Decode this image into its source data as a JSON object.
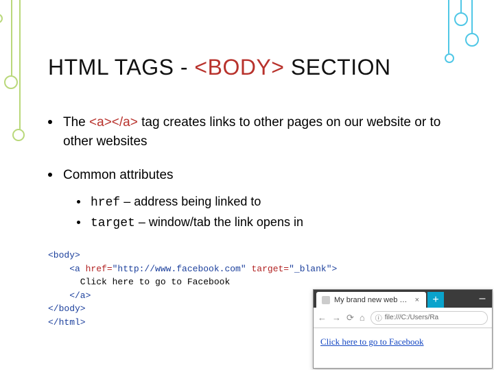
{
  "title": {
    "prefix": "HTML TAGS - ",
    "highlight": "<BODY>",
    "suffix": " SECTION"
  },
  "bullets": {
    "first": {
      "pre": "The ",
      "tag": "<a></a>",
      "post": " tag creates links to other pages on our website or to other websites"
    },
    "second": {
      "label": "Common attributes",
      "sub": [
        {
          "attr": "href",
          "desc": " – address being linked to"
        },
        {
          "attr": "target",
          "desc": " – window/tab the link opens in"
        }
      ]
    }
  },
  "code": {
    "l1": "<body>",
    "l2_open": "    <a ",
    "l2_attr1": "href=",
    "l2_val1": "\"http://www.facebook.com\"",
    "l2_sp": " ",
    "l2_attr2": "target=",
    "l2_val2": "\"_blank\"",
    "l2_close": ">",
    "l3": "      Click here to go to Facebook",
    "l4": "    </a>",
    "l5": "</body>",
    "l6": "</html>"
  },
  "browser": {
    "tab_title": "My brand new web page",
    "tab_close": "×",
    "newtab": "+",
    "minimize": "–",
    "nav_back": "←",
    "nav_fwd": "→",
    "nav_reload": "⟳",
    "nav_home": "⌂",
    "url_prefix": "ⓘ",
    "url": "file:///C:/Users/Ra",
    "link_text": "Click here to go to Facebook"
  }
}
